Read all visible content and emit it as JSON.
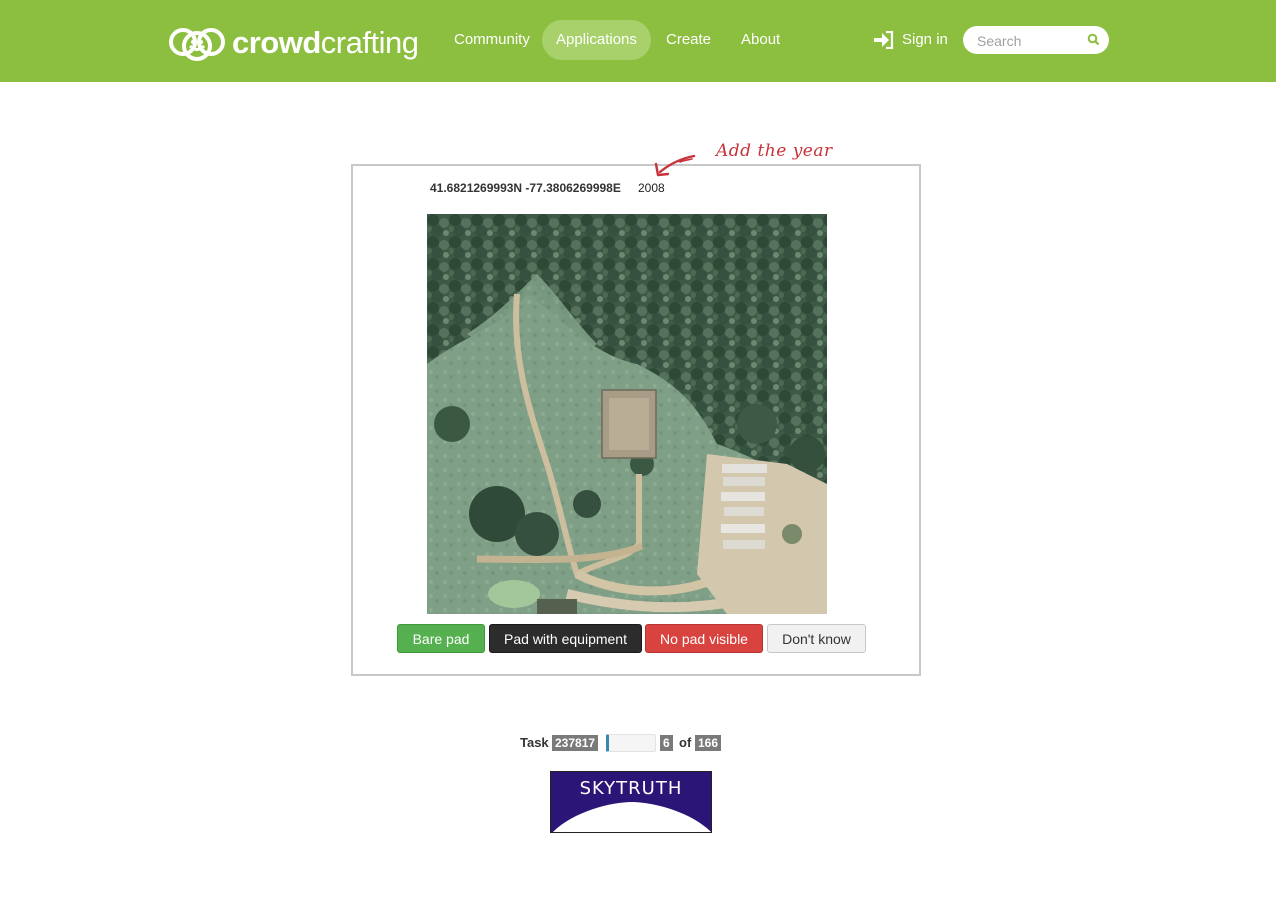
{
  "nav": {
    "brand_bold": "crowd",
    "brand_light": "crafting",
    "items": [
      {
        "label": "Community",
        "active": false
      },
      {
        "label": "Applications",
        "active": true
      },
      {
        "label": "Create",
        "active": false
      },
      {
        "label": "About",
        "active": false
      }
    ],
    "signin_label": "Sign in",
    "search_placeholder": "Search",
    "icons": {
      "signin": "sign-in-icon",
      "search": "search-icon"
    }
  },
  "task": {
    "coordinates": "41.6821269993N -77.3806269998E",
    "year": "2008",
    "annotation": "Add the year",
    "buttons": {
      "bare_pad": "Bare pad",
      "pad_with_equipment": "Pad with equipment",
      "no_pad_visible": "No pad visible",
      "dont_know": "Don't know"
    }
  },
  "progress": {
    "task_label": "Task",
    "task_id": "237817",
    "current": "6",
    "of_label": "of",
    "total": "166"
  },
  "logo": {
    "text": "SKYTRUTH"
  },
  "colors": {
    "navbar": "#8cbf3f",
    "nav_active": "#a8d16c",
    "green_button": "#55b04f",
    "dark_button": "#2c2c2c",
    "red_button": "#d9433f",
    "annotation_red": "#c8323a",
    "skytruth_navy": "#2b1577"
  }
}
